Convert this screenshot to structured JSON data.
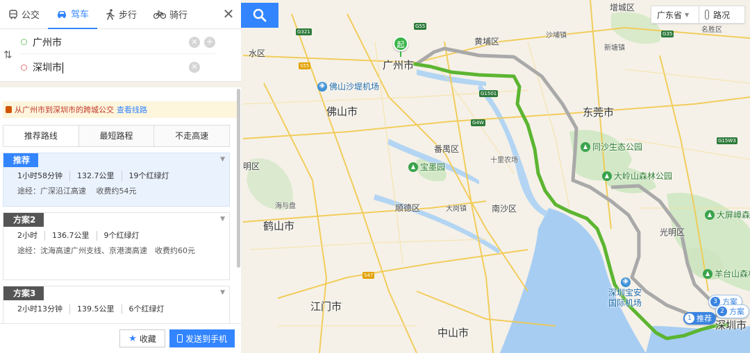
{
  "map": {
    "cities": [
      {
        "name": "广州市",
        "pos": "guangzhou"
      },
      {
        "name": "佛山市",
        "pos": "foshan"
      },
      {
        "name": "东莞市",
        "pos": "dongguan"
      },
      {
        "name": "江门市",
        "pos": "jiangmen"
      },
      {
        "name": "中山市",
        "pos": "zhongshan"
      },
      {
        "name": "鹤山市",
        "pos": "heshan"
      },
      {
        "name": "深圳市",
        "pos": "shenzhen"
      }
    ],
    "districts": {
      "huangpu": "黄埔区",
      "panyu": "番禺区",
      "shunde": "顺德区",
      "nansha": "南沙区",
      "guangming": "光明区",
      "shui": "水区",
      "ming": "明区",
      "zengcheng": "增城区"
    },
    "small": {
      "shatian": "沙埔镇",
      "xintang": "新塘镇",
      "shijie": "十里农场",
      "dagang": "大岗镇",
      "haiyin": "海与盘",
      "mingyan": "名胜区"
    },
    "pois": {
      "tongsha": "同沙生态公园",
      "daling": "大岭山森林公园",
      "dapingzhang": "大屏嶂森",
      "yangtai": "羊台山森林公园",
      "baomo": "宝墨园"
    },
    "airports": {
      "baiyun": "佛山沙堤机场",
      "baoan": "深圳宝安国际机场"
    },
    "shields": [
      "G321",
      "G55",
      "S55",
      "G1501",
      "G4W",
      "G35",
      "G15W3",
      "S47"
    ],
    "start_marker": "起",
    "route_tags": {
      "rec_num": "1",
      "rec_label": "推荐",
      "p2_num": "2",
      "p2_label": "方案",
      "p3_num": "3",
      "p3_label": "方案"
    },
    "colors": {
      "route_main": "#5cb531",
      "route_alt": "#a9a9a9",
      "water": "#a7cdf2",
      "green": "#c9e3bd"
    }
  },
  "controls": {
    "province": "广东省",
    "traffic": "路况"
  },
  "modes": [
    {
      "label": "公交",
      "icon": "bus-icon"
    },
    {
      "label": "驾车",
      "icon": "car-icon"
    },
    {
      "label": "步行",
      "icon": "walk-icon"
    },
    {
      "label": "骑行",
      "icon": "bike-icon"
    }
  ],
  "inputs": {
    "start": "广州市",
    "end": "深圳市"
  },
  "bus_tip": {
    "text": "从广州市到深圳市的跨城公交",
    "link": "查看线路"
  },
  "route_tabs": [
    "推荐路线",
    "最短路程",
    "不走高速"
  ],
  "plans": [
    {
      "tag": "推荐",
      "duration": "1小时58分钟",
      "distance": "132.7公里",
      "lights": "19个红绿灯",
      "via": "途经：广深沿江高速　 收费约54元"
    },
    {
      "tag": "方案2",
      "duration": "2小时",
      "distance": "136.7公里",
      "lights": "9个红绿灯",
      "via": "途经：沈海高速广州支线、京港澳高速　收费约60元"
    },
    {
      "tag": "方案3",
      "duration": "2小时13分钟",
      "distance": "139.5公里",
      "lights": "6个红绿灯",
      "via": ""
    }
  ],
  "bottom": {
    "fav": "收藏",
    "send": "发送到手机"
  }
}
